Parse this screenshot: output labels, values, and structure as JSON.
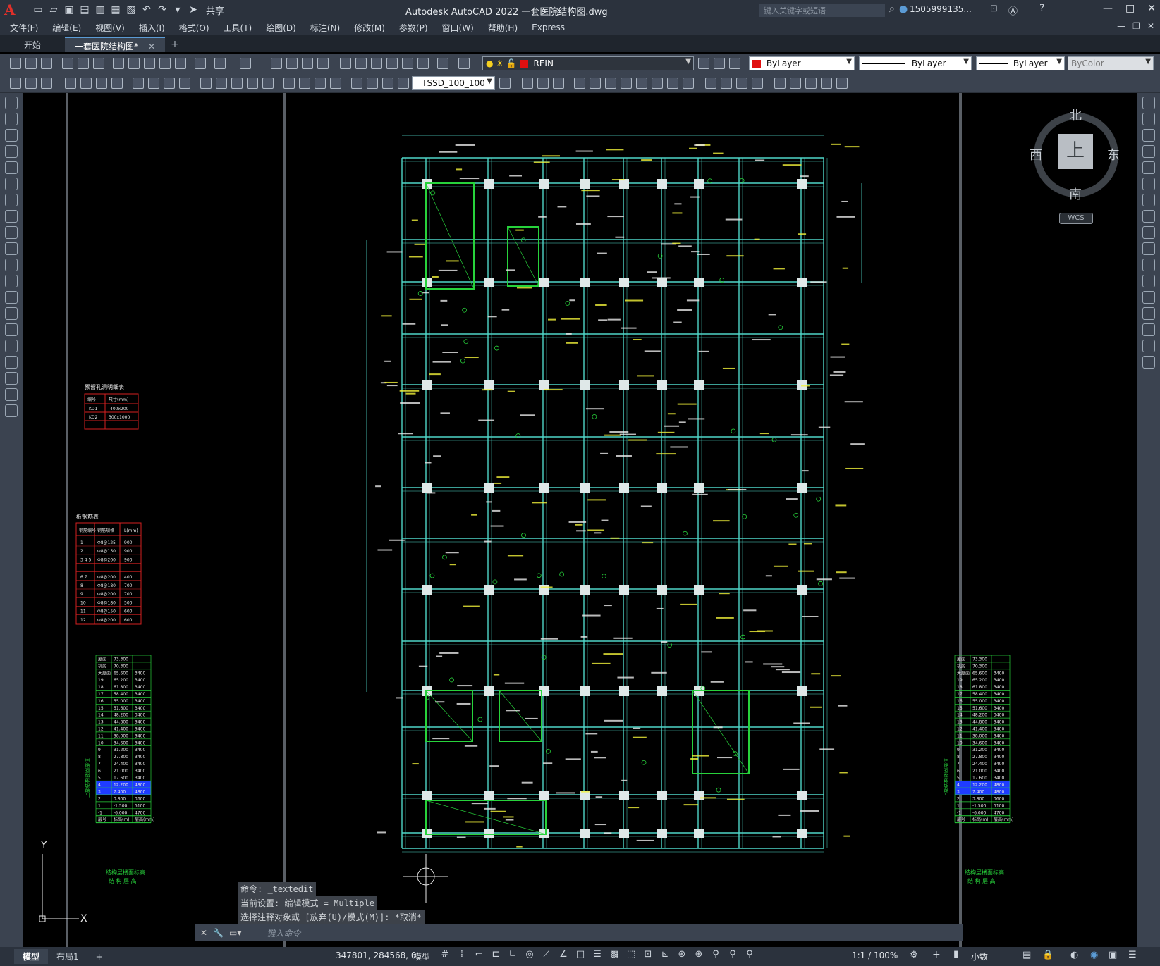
{
  "app": {
    "title": "Autodesk AutoCAD 2022    一套医院结构图.dwg",
    "share_label": "共享",
    "search_placeholder": "键入关键字或短语",
    "user_name": "1505999135...",
    "logo_letter": "A"
  },
  "menu": [
    "文件(F)",
    "编辑(E)",
    "视图(V)",
    "插入(I)",
    "格式(O)",
    "工具(T)",
    "绘图(D)",
    "标注(N)",
    "修改(M)",
    "参数(P)",
    "窗口(W)",
    "帮助(H)",
    "Express"
  ],
  "tabs": [
    {
      "label": "开始"
    },
    {
      "label": "一套医院结构图*"
    }
  ],
  "toolbar1": {
    "layer_name": "REIN",
    "color": "ByLayer",
    "linetype": "ByLayer",
    "lineweight": "ByLayer",
    "plotstyle": "ByColor"
  },
  "toolbar2": {
    "dimstyle": "TSSD_100_100"
  },
  "viewcube": {
    "top": "上",
    "north": "北",
    "south": "南",
    "east": "东",
    "west": "西",
    "wcs": "WCS"
  },
  "ucs": {
    "x": "X",
    "y": "Y"
  },
  "drawing": {
    "table1_title": "预留孔洞明细表",
    "table1_headers": [
      "编号",
      "尺寸(mm)"
    ],
    "table1_rows": [
      [
        "KD1",
        "400x200"
      ],
      [
        "KD2",
        "300x1000"
      ],
      [
        "",
        ""
      ]
    ],
    "table2_title": "板钢筋表",
    "table2_headers": [
      "钢筋编号",
      "钢筋规格",
      "L(mm)"
    ],
    "table2_rows": [
      [
        "1",
        "Φ8@125",
        "900"
      ],
      [
        "2",
        "Φ8@150",
        "900"
      ],
      [
        "3 4 5",
        "Φ8@200",
        "900"
      ],
      [
        "",
        "",
        ""
      ],
      [
        "6 7",
        "Φ8@200",
        "400"
      ],
      [
        "8",
        "Φ8@180",
        "700"
      ],
      [
        "9",
        "Φ8@200",
        "700"
      ],
      [
        "10",
        "Φ8@180",
        "500"
      ],
      [
        "11",
        "Φ8@150",
        "600"
      ],
      [
        "12",
        "Φ8@200",
        "600"
      ]
    ],
    "floor_headers": [
      "层号",
      "标高(m)",
      "层高(mm)"
    ],
    "floors": [
      [
        "屋面",
        "73.300",
        ""
      ],
      [
        "机房",
        "70.300",
        ""
      ],
      [
        "大屋面",
        "65.600",
        "3400"
      ],
      [
        "19",
        "65.200",
        "3400"
      ],
      [
        "18",
        "61.800",
        "3400"
      ],
      [
        "17",
        "58.400",
        "3400"
      ],
      [
        "16",
        "55.000",
        "3400"
      ],
      [
        "15",
        "51.600",
        "3400"
      ],
      [
        "14",
        "48.200",
        "3400"
      ],
      [
        "13",
        "44.800",
        "3400"
      ],
      [
        "12",
        "41.400",
        "3400"
      ],
      [
        "11",
        "38.000",
        "3400"
      ],
      [
        "10",
        "34.600",
        "3400"
      ],
      [
        "9",
        "31.200",
        "3400"
      ],
      [
        "8",
        "27.800",
        "3400"
      ],
      [
        "7",
        "24.400",
        "3400"
      ],
      [
        "6",
        "21.000",
        "3400"
      ],
      [
        "5",
        "17.600",
        "3400"
      ],
      [
        "4",
        "12.200",
        "4800"
      ],
      [
        "3",
        "7.400",
        "4800"
      ],
      [
        "2",
        "3.800",
        "3600"
      ],
      [
        "1",
        "-1.500",
        "5100"
      ],
      [
        "-1",
        "-6.000",
        "4700"
      ]
    ],
    "floor_caption1": "结构层楼面标高",
    "floor_caption2": "结 构 层 高",
    "highlight_floors": [
      "4",
      "3"
    ],
    "left_vlabel": "上部结构嵌固部位"
  },
  "command_history": [
    "命令: _textedit",
    "当前设置: 编辑模式 = Multiple",
    "选择注释对象或 [放弃(U)/模式(M)]: *取消*"
  ],
  "command_placeholder": "键入命令",
  "status": {
    "tabs": [
      "模型",
      "布局1"
    ],
    "coords": "347801, 284568, 0",
    "space": "模型",
    "scale": "1:1 / 100%",
    "units": "小数"
  },
  "colors": {
    "bg": "#000000",
    "grid": "#4fd6c8",
    "label_yellow": "#f2f23a",
    "label_white": "#e8e8e8",
    "table_red": "#d42020",
    "green": "#27d23b",
    "ui_dark": "#2b323d",
    "ui_mid": "#3b4350"
  }
}
